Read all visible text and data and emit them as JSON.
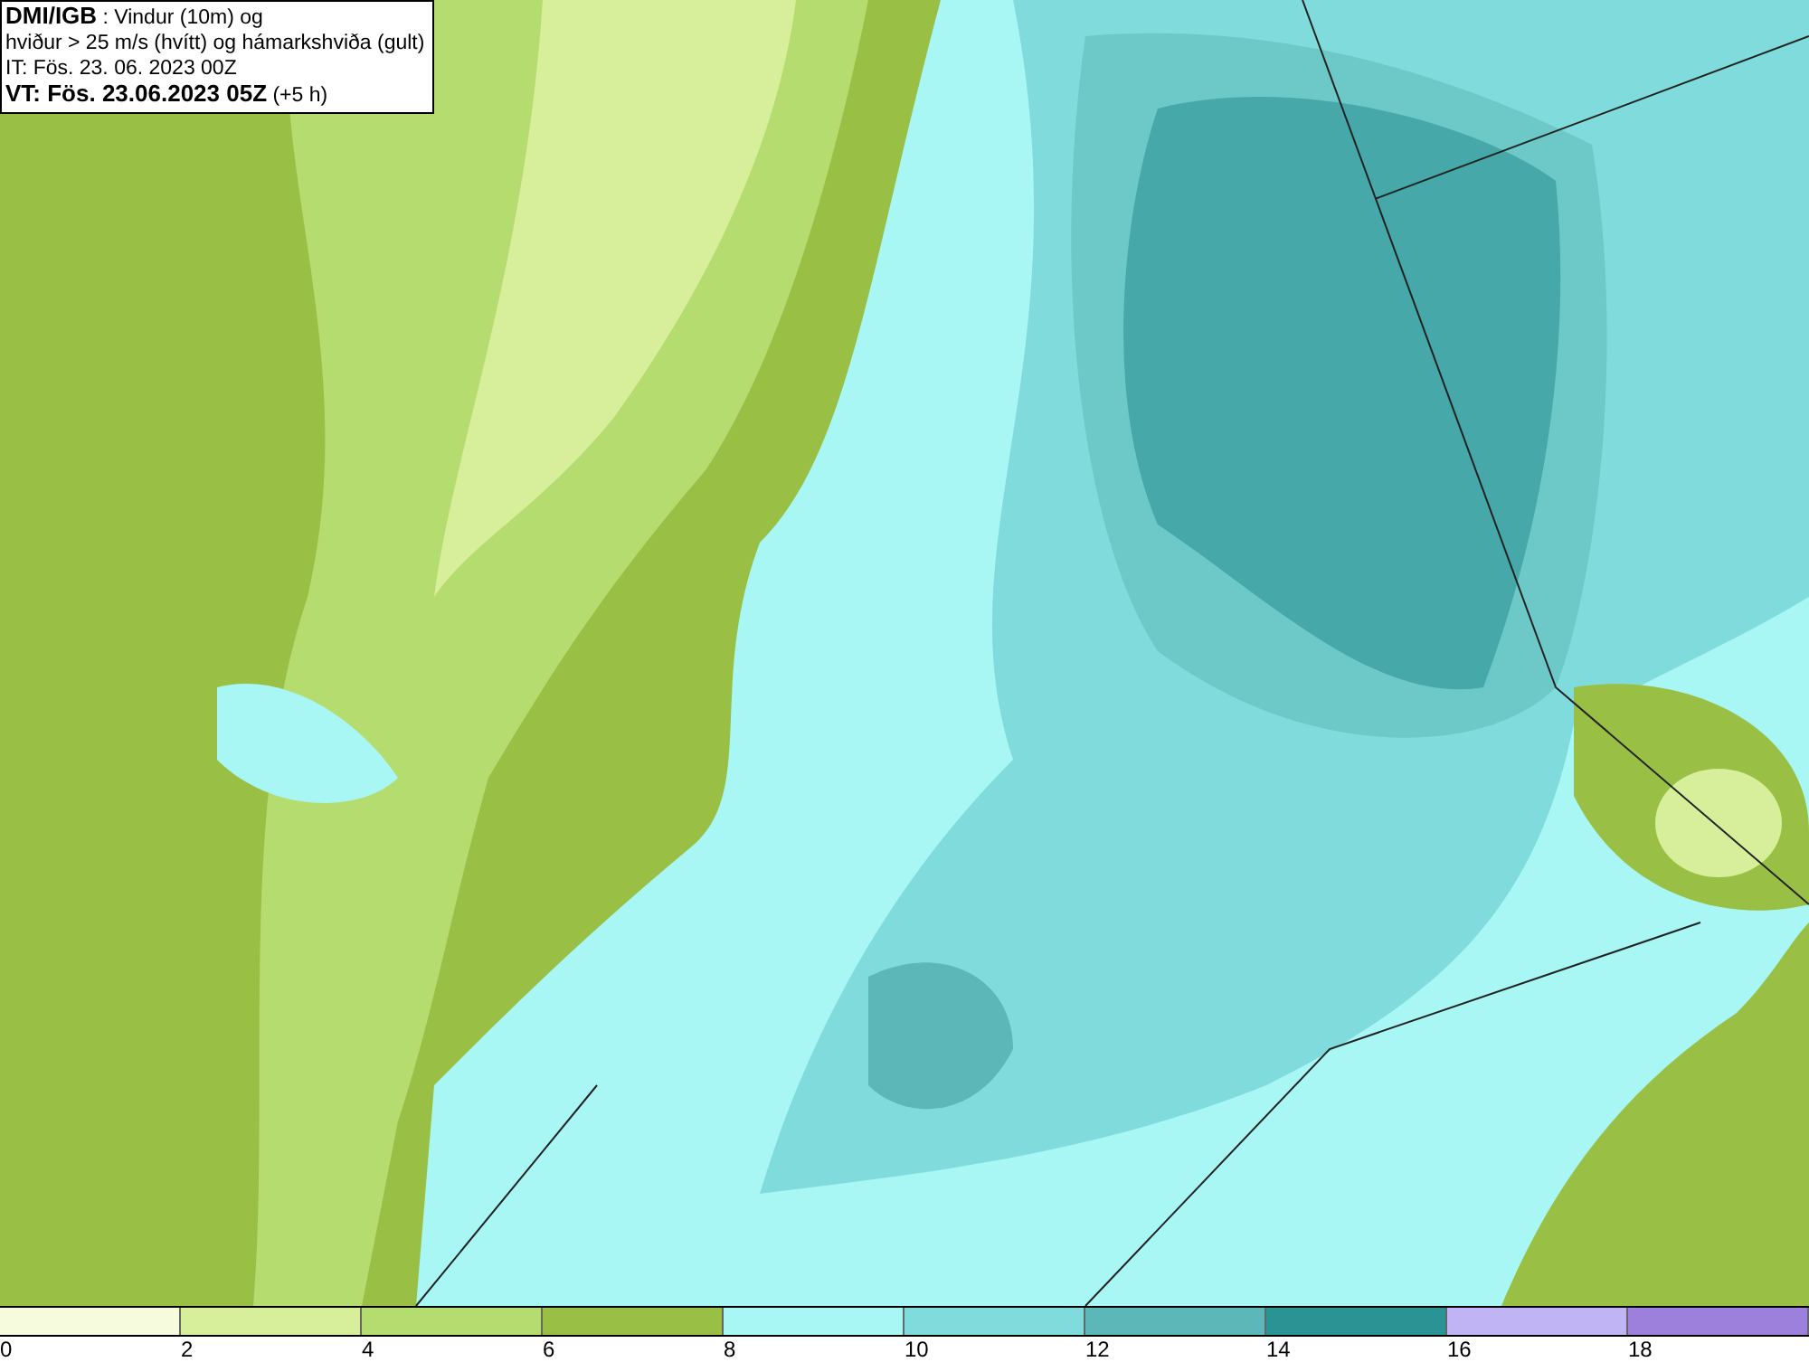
{
  "title_box": {
    "lines": [
      "**DMI/IGB** : Vindur (10m) og",
      "hviður > 25 m/s (hvítt) og hámarkshviða (gult)",
      "IT: Fös. 23. 06. 2023 00Z",
      "**VT: Fös. 23.06.2023 05Z** (+5 h)"
    ]
  },
  "legend": {
    "bins": [
      {
        "color": "#f5fbdc"
      },
      {
        "color": "#d7ee9a"
      },
      {
        "color": "#b4dc6e"
      },
      {
        "color": "#99c044"
      },
      {
        "color": "#a8f7f5"
      },
      {
        "color": "#80dcdc"
      },
      {
        "color": "#5cb8b8"
      },
      {
        "color": "#2a9494"
      },
      {
        "color": "#c0b4f4"
      },
      {
        "color": "#9c80dc"
      }
    ],
    "ticks": [
      "0",
      "2",
      "4",
      "6",
      "8",
      "10",
      "12",
      "14",
      "16",
      "18"
    ]
  }
}
